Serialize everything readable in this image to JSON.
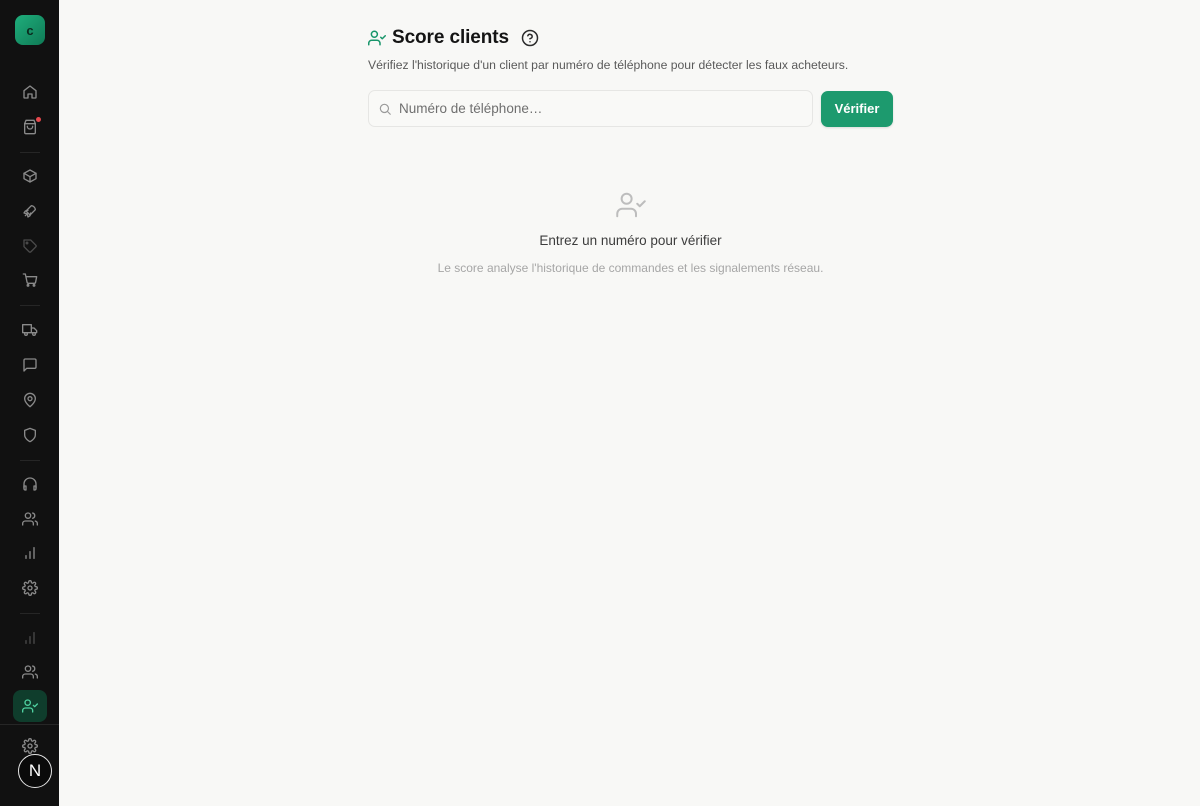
{
  "sidebar": {
    "logo_letter": "c",
    "avatar_letter": "N",
    "items": [
      {
        "name": "home-icon"
      },
      {
        "name": "shopping-bag-icon",
        "badge": true
      },
      {
        "name": "box-icon"
      },
      {
        "name": "rocket-icon"
      },
      {
        "name": "tag-icon"
      },
      {
        "name": "cart-icon"
      },
      {
        "name": "truck-icon"
      },
      {
        "name": "message-icon"
      },
      {
        "name": "map-pin-icon"
      },
      {
        "name": "shield-icon"
      },
      {
        "name": "headphones-icon"
      },
      {
        "name": "users-icon"
      },
      {
        "name": "bar-chart-icon"
      },
      {
        "name": "settings-icon"
      },
      {
        "name": "bar-chart-icon"
      },
      {
        "name": "users-icon"
      },
      {
        "name": "user-check-icon",
        "active": true
      },
      {
        "name": "settings-icon"
      }
    ]
  },
  "page": {
    "title": "Score clients",
    "subtitle": "Vérifiez l'historique d'un client par numéro de téléphone pour détecter les faux acheteurs."
  },
  "search": {
    "placeholder": "Numéro de téléphone…",
    "value": "",
    "button_label": "Vérifier"
  },
  "empty_state": {
    "title": "Entrez un numéro pour vérifier",
    "description": "Le score analyse l'historique de commandes et les signalements réseau."
  },
  "colors": {
    "accent": "#1d9a6e",
    "sidebar_bg": "#111111",
    "page_bg": "#f8f8f6",
    "notification": "#e5484d"
  }
}
